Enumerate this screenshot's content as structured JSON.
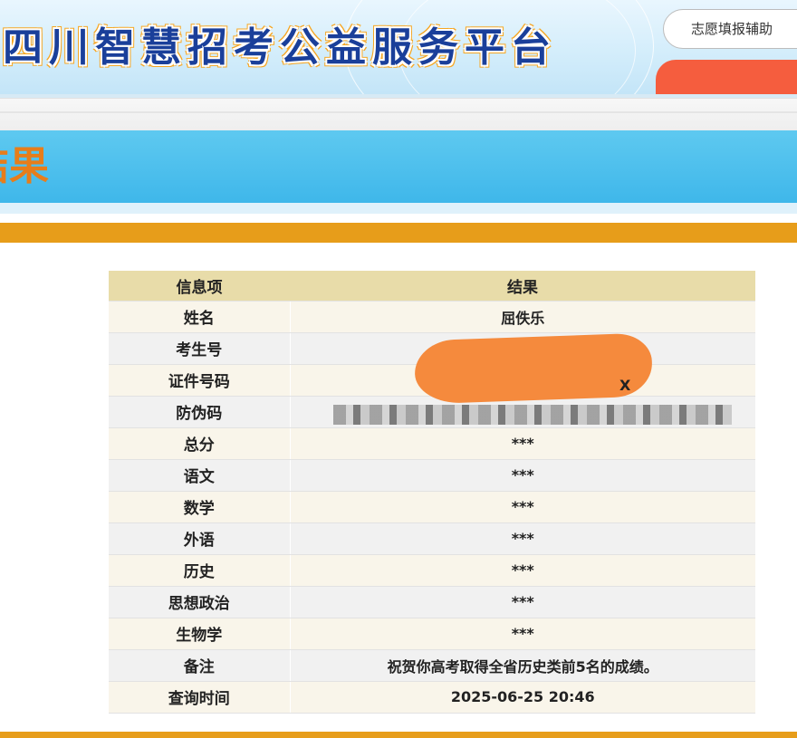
{
  "header": {
    "platform_title_chars": [
      "四",
      "川",
      "智",
      "慧",
      "招",
      "考",
      "公",
      "益",
      "服",
      "务",
      "平",
      "台"
    ],
    "aid_button_label": "志愿填报辅助"
  },
  "banner": {
    "title": "结果"
  },
  "table": {
    "header": {
      "item": "信息项",
      "result": "结果"
    },
    "rows": [
      {
        "label": "姓名",
        "value": "屈佚乐"
      },
      {
        "label": "考生号",
        "value": ""
      },
      {
        "label": "证件号码",
        "value": ""
      },
      {
        "label": "防伪码",
        "value": ""
      },
      {
        "label": "总分",
        "value": "***"
      },
      {
        "label": "语文",
        "value": "***"
      },
      {
        "label": "数学",
        "value": "***"
      },
      {
        "label": "外语",
        "value": "***"
      },
      {
        "label": "历史",
        "value": "***"
      },
      {
        "label": "思想政治",
        "value": "***"
      },
      {
        "label": "生物学",
        "value": "***"
      },
      {
        "label": "备注",
        "value": "祝贺你高考取得全省历史类前5名的成绩。"
      },
      {
        "label": "查询时间",
        "value": "2025-06-25 20:46"
      }
    ],
    "id_suffix_visible": "X"
  },
  "colors": {
    "accent_orange": "#e79d1a",
    "banner_blue": "#3fb7ea",
    "title_blue": "#1a3f9a",
    "header_row": "#e8dca9",
    "redaction_orange": "#f58a3d"
  }
}
